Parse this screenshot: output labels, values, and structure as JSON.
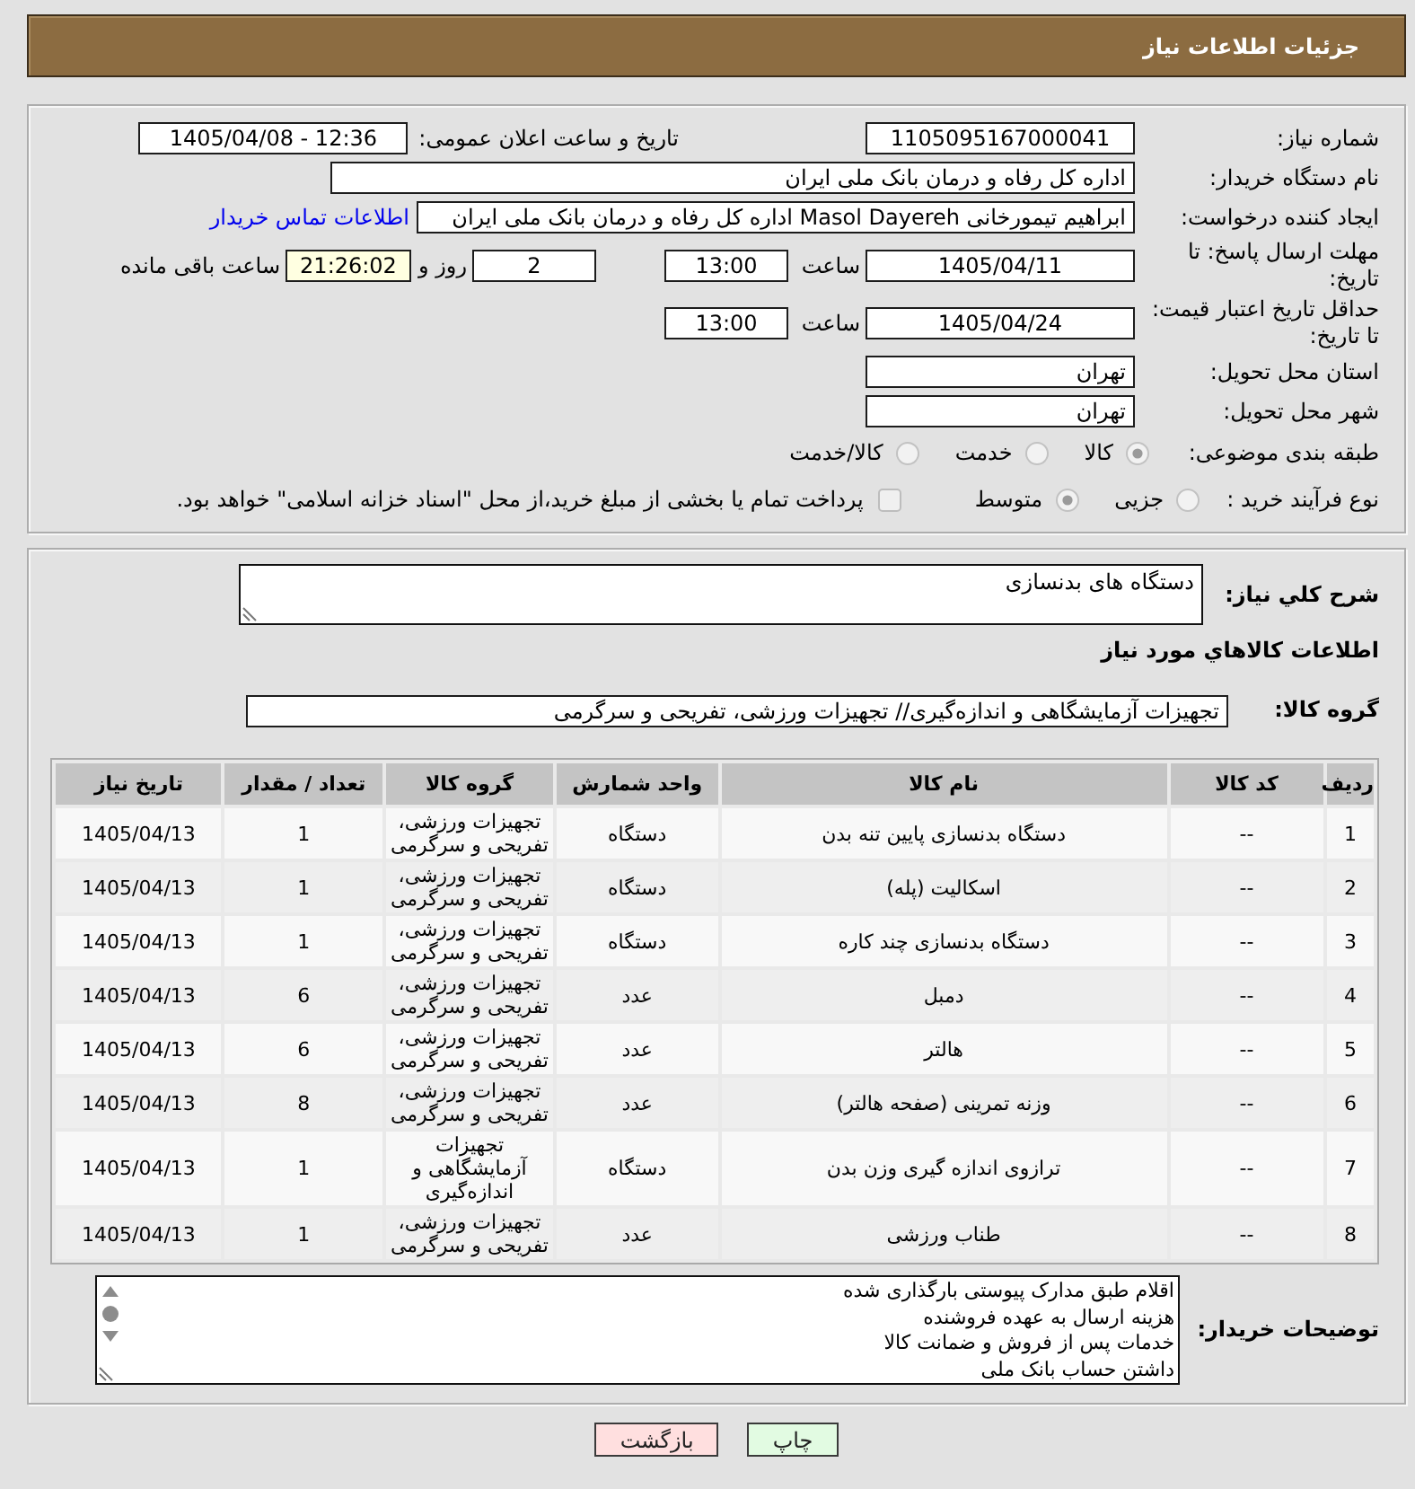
{
  "header": {
    "title": "جزئیات اطلاعات نیاز"
  },
  "need_number": {
    "label": "شماره نیاز:",
    "value": "1105095167000041"
  },
  "announcement": {
    "label": "تاریخ و ساعت اعلان عمومی:",
    "value": "1405/04/08 - 12:36"
  },
  "buyer_org": {
    "label": "نام دستگاه خریدار:",
    "value": "اداره کل رفاه و درمان بانک ملی ایران"
  },
  "requester": {
    "label": "ایجاد کننده درخواست:",
    "value": "ابراهیم تیمورخانی Masol Dayereh اداره کل رفاه و درمان بانک ملی ایران",
    "contact_link": "اطلاعات تماس خریدار"
  },
  "response_deadline": {
    "label": "مهلت ارسال پاسخ: تا تاریخ:",
    "date": "1405/04/11",
    "time_label": "ساعت",
    "time": "13:00",
    "days": "2",
    "days_label": "روز و",
    "remaining": "21:26:02",
    "remaining_label": "ساعت باقی مانده"
  },
  "price_validity": {
    "label": "حداقل تاریخ اعتبار قیمت: تا تاریخ:",
    "date": "1405/04/24",
    "time_label": "ساعت",
    "time": "13:00"
  },
  "delivery_province": {
    "label": "استان محل تحویل:",
    "value": "تهران"
  },
  "delivery_city": {
    "label": "شهر محل تحویل:",
    "value": "تهران"
  },
  "subject_category": {
    "label": "طبقه بندی موضوعی:",
    "options": [
      {
        "label": "کالا",
        "selected": true,
        "disabled": true
      },
      {
        "label": "خدمت",
        "selected": false,
        "disabled": true
      },
      {
        "label": "کالا/خدمت",
        "selected": false,
        "disabled": true
      }
    ]
  },
  "purchase_process": {
    "label": "نوع فرآیند خرید :",
    "options": [
      {
        "label": "جزیی",
        "selected": false,
        "disabled": true
      },
      {
        "label": "متوسط",
        "selected": true,
        "disabled": true
      }
    ],
    "treasury_payment": {
      "label": "پرداخت تمام یا بخشی از مبلغ خرید،از محل \"اسناد خزانه اسلامی\" خواهد بود.",
      "checked": false,
      "disabled": true
    }
  },
  "description": {
    "label": "شرح کلي نياز:",
    "value": "دستگاه های بدنسازی"
  },
  "goods_section": {
    "title": "اطلاعات کالاهاي مورد نياز"
  },
  "goods_group": {
    "label": "گروه کالا:",
    "value": "تجهیزات آزمایشگاهی و اندازه‌گیری// تجهیزات ورزشی، تفریحی و سرگرمی"
  },
  "table": {
    "columns": [
      "ردیف",
      "کد کالا",
      "نام کالا",
      "واحد شمارش",
      "گروه کالا",
      "تعداد / مقدار",
      "تاریخ نیاز"
    ],
    "rows": [
      [
        "1",
        "--",
        "دستگاه بدنسازی پایین تنه بدن",
        "دستگاه",
        "تجهیزات ورزشی، تفریحی و سرگرمی",
        "1",
        "1405/04/13"
      ],
      [
        "2",
        "--",
        "اسکالیت (پله)",
        "دستگاه",
        "تجهیزات ورزشی، تفریحی و سرگرمی",
        "1",
        "1405/04/13"
      ],
      [
        "3",
        "--",
        "دستگاه بدنسازی چند کاره",
        "دستگاه",
        "تجهیزات ورزشی، تفریحی و سرگرمی",
        "1",
        "1405/04/13"
      ],
      [
        "4",
        "--",
        "دمبل",
        "عدد",
        "تجهیزات ورزشی، تفریحی و سرگرمی",
        "6",
        "1405/04/13"
      ],
      [
        "5",
        "--",
        "هالتر",
        "عدد",
        "تجهیزات ورزشی، تفریحی و سرگرمی",
        "6",
        "1405/04/13"
      ],
      [
        "6",
        "--",
        "وزنه تمرینی (صفحه هالتر)",
        "عدد",
        "تجهیزات ورزشی، تفریحی و سرگرمی",
        "8",
        "1405/04/13"
      ],
      [
        "7",
        "--",
        "ترازوی اندازه گیری وزن بدن",
        "دستگاه",
        "تجهیزات آزمایشگاهی و اندازه‌گیری",
        "1",
        "1405/04/13"
      ],
      [
        "8",
        "--",
        "طناب ورزشی",
        "عدد",
        "تجهیزات ورزشی، تفریحی و سرگرمی",
        "1",
        "1405/04/13"
      ]
    ]
  },
  "buyer_notes": {
    "label": "توضیحات خریدار:",
    "lines": [
      "اقلام طبق مدارک پیوستی بارگذاری شده",
      "هزینه ارسال به عهده فروشنده",
      "خدمات پس از فروش و ضمانت کالا",
      "داشتن حساب بانک ملی"
    ]
  },
  "buttons": [
    {
      "label": "چاپ",
      "kind": "print"
    },
    {
      "label": "بازگشت",
      "kind": "back"
    }
  ]
}
